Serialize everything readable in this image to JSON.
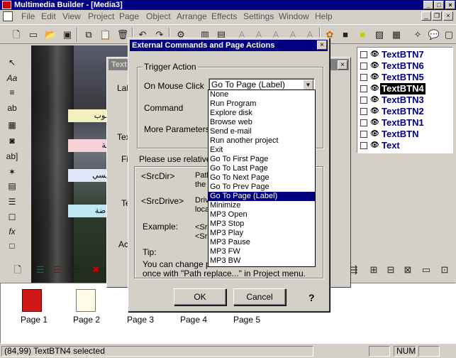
{
  "app": {
    "title": "Multimedia Builder - [Media3]"
  },
  "menu": [
    "File",
    "Edit",
    "View",
    "Project",
    "Page",
    "Object",
    "Arrange",
    "Effects",
    "Settings",
    "Window",
    "Help"
  ],
  "toolbar_icons": [
    "new-doc-icon",
    "new-page-icon",
    "open-folder-icon",
    "save-icon",
    "copy-icon",
    "paste-icon",
    "delete-icon",
    "undo-icon",
    "redo-icon",
    "tools-icon",
    "grid-icon",
    "align-icon",
    "text-a-icon",
    "text-a-icon",
    "text-a-icon",
    "text-a-icon",
    "text-a-icon",
    "text-a-icon",
    "fill-icon",
    "stop-icon",
    "square-icon",
    "square-icon",
    "bitmap-icon",
    "eraser-icon",
    "magic-icon",
    "bubble-icon",
    "box-icon"
  ],
  "left_tools": [
    {
      "icon": "arrow-icon",
      "glyph": "↖"
    },
    {
      "icon": "text-icon",
      "glyph": "Aa"
    },
    {
      "icon": "paragraph-icon",
      "glyph": "≡"
    },
    {
      "icon": "button-ab-icon",
      "glyph": "ab"
    },
    {
      "icon": "bitmap-button-icon",
      "glyph": "▦"
    },
    {
      "icon": "mask-icon",
      "glyph": "◙"
    },
    {
      "icon": "text-button-icon",
      "glyph": "ab]"
    },
    {
      "icon": "gif-icon",
      "glyph": "✶"
    },
    {
      "icon": "film-icon",
      "glyph": "▤"
    },
    {
      "icon": "list-icon",
      "glyph": "☰"
    },
    {
      "icon": "checkbox-icon",
      "glyph": "☐"
    },
    {
      "icon": "fx-icon",
      "glyph": "fx"
    },
    {
      "icon": "rectangle-icon",
      "glyph": "□"
    }
  ],
  "canvas_buttons": [
    "حاسوب",
    "الفنية",
    "تأسيسي",
    "الرياضة"
  ],
  "objects": [
    {
      "label": "TextBTN7",
      "selected": false
    },
    {
      "label": "TextBTN6",
      "selected": false
    },
    {
      "label": "TextBTN5",
      "selected": false
    },
    {
      "label": "TextBTN4",
      "selected": true
    },
    {
      "label": "TextBTN3",
      "selected": false
    },
    {
      "label": "TextBTN2",
      "selected": false
    },
    {
      "label": "TextBTN1",
      "selected": false
    },
    {
      "label": "TextBTN",
      "selected": false
    },
    {
      "label": "Text",
      "selected": false
    }
  ],
  "bg_dialog": {
    "title": "Text",
    "frag_lab": "Lab",
    "frag_tex": "Tex",
    "frag_fi": "Fi",
    "frag_te": "Te",
    "frag_ac": "Ac"
  },
  "dialog": {
    "title": "External Commands and Page Actions",
    "group": "Trigger Action",
    "on_mouse_click_label": "On Mouse Click",
    "command_label": "Command",
    "more_params_label": "More Parameters",
    "selected_action": "Go To Page (Label)",
    "relative_hint": "Please use relative p",
    "srcdir": "<SrcDir>",
    "srcdir_desc": "Path\nthe",
    "srcdrive": "<SrcDrive>",
    "srcdrive_desc": "Drive\nloca",
    "example": "Example:",
    "example_desc": "<Src\n<Src",
    "tip_label": "Tip:",
    "tip_text": "You can change pa",
    "tip_text2": "once with \"Path replace...\" in Project menu.",
    "ok": "OK",
    "cancel": "Cancel",
    "help": "?",
    "options": [
      "None",
      "Run Program",
      "Explore disk",
      "Browse web",
      "Send e-mail",
      "Run another project",
      "Exit",
      "Go To First Page",
      "Go To Last Page",
      "Go To Next Page",
      "Go To Prev Page",
      "Go To Page (Label)",
      "Minimize",
      "MP3 Open",
      "MP3 Stop",
      "MP3 Play",
      "MP3 Pause",
      "MP3 FW",
      "MP3 BW"
    ],
    "selected_index": 11
  },
  "pages": [
    "Page 1",
    "Page 2",
    "Page 3",
    "Page 4",
    "Page 5"
  ],
  "status": {
    "coords": "(84,99)",
    "message": "TextBTN4 selected",
    "num": "NUM"
  },
  "colors": {
    "titlebar": "#000080",
    "selection": "#000080",
    "object_text": "#000080"
  }
}
